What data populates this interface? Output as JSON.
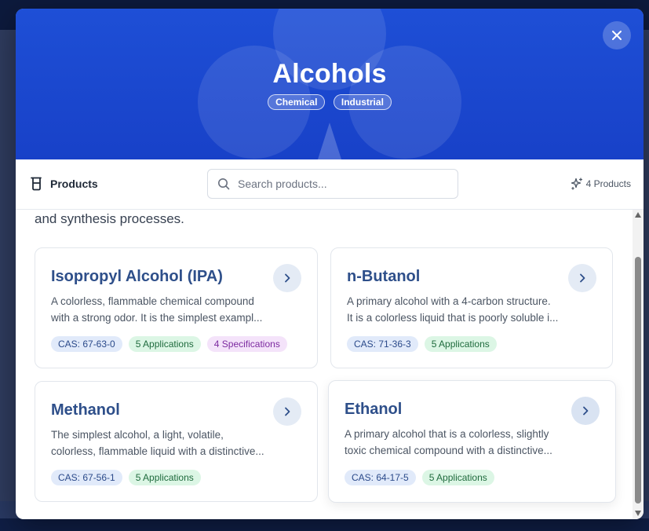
{
  "category": {
    "title": "Alcohols",
    "tags": [
      "Chemical",
      "Industrial"
    ]
  },
  "toolbar": {
    "section_label": "Products",
    "search_placeholder": "Search products...",
    "product_count": "4 Products"
  },
  "intro_text": "and synthesis processes.",
  "products": [
    {
      "name": "Isopropyl Alcohol (IPA)",
      "description_line1": "A colorless, flammable chemical compound",
      "description_line2": "with a strong odor. It is the simplest exampl...",
      "cas": "CAS: 67-63-0",
      "applications": "5 Applications",
      "specifications": "4 Specifications"
    },
    {
      "name": "n-Butanol",
      "description_line1": "A primary alcohol with a 4-carbon structure.",
      "description_line2": "It is a colorless liquid that is poorly soluble i...",
      "cas": "CAS: 71-36-3",
      "applications": "5 Applications"
    },
    {
      "name": "Methanol",
      "description_line1": "The simplest alcohol, a light, volatile,",
      "description_line2": "colorless, flammable liquid with a distinctive...",
      "cas": "CAS: 67-56-1",
      "applications": "5 Applications"
    },
    {
      "name": "Ethanol",
      "description_line1": "A primary alcohol that is a colorless, slightly",
      "description_line2": "toxic chemical compound with a distinctive...",
      "cas": "CAS: 64-17-5",
      "applications": "5 Applications"
    }
  ],
  "icons": {
    "close": "close-icon",
    "products": "beaker-icon",
    "search": "search-icon",
    "count": "sparkles-icon",
    "open": "chevron-right-icon"
  },
  "colors": {
    "hero": "#1d4fd8",
    "product_name": "#2e4f8a",
    "cas_badge": "#e1eafa",
    "app_badge": "#dcf6e5",
    "spec_badge": "#f4e3fa"
  }
}
